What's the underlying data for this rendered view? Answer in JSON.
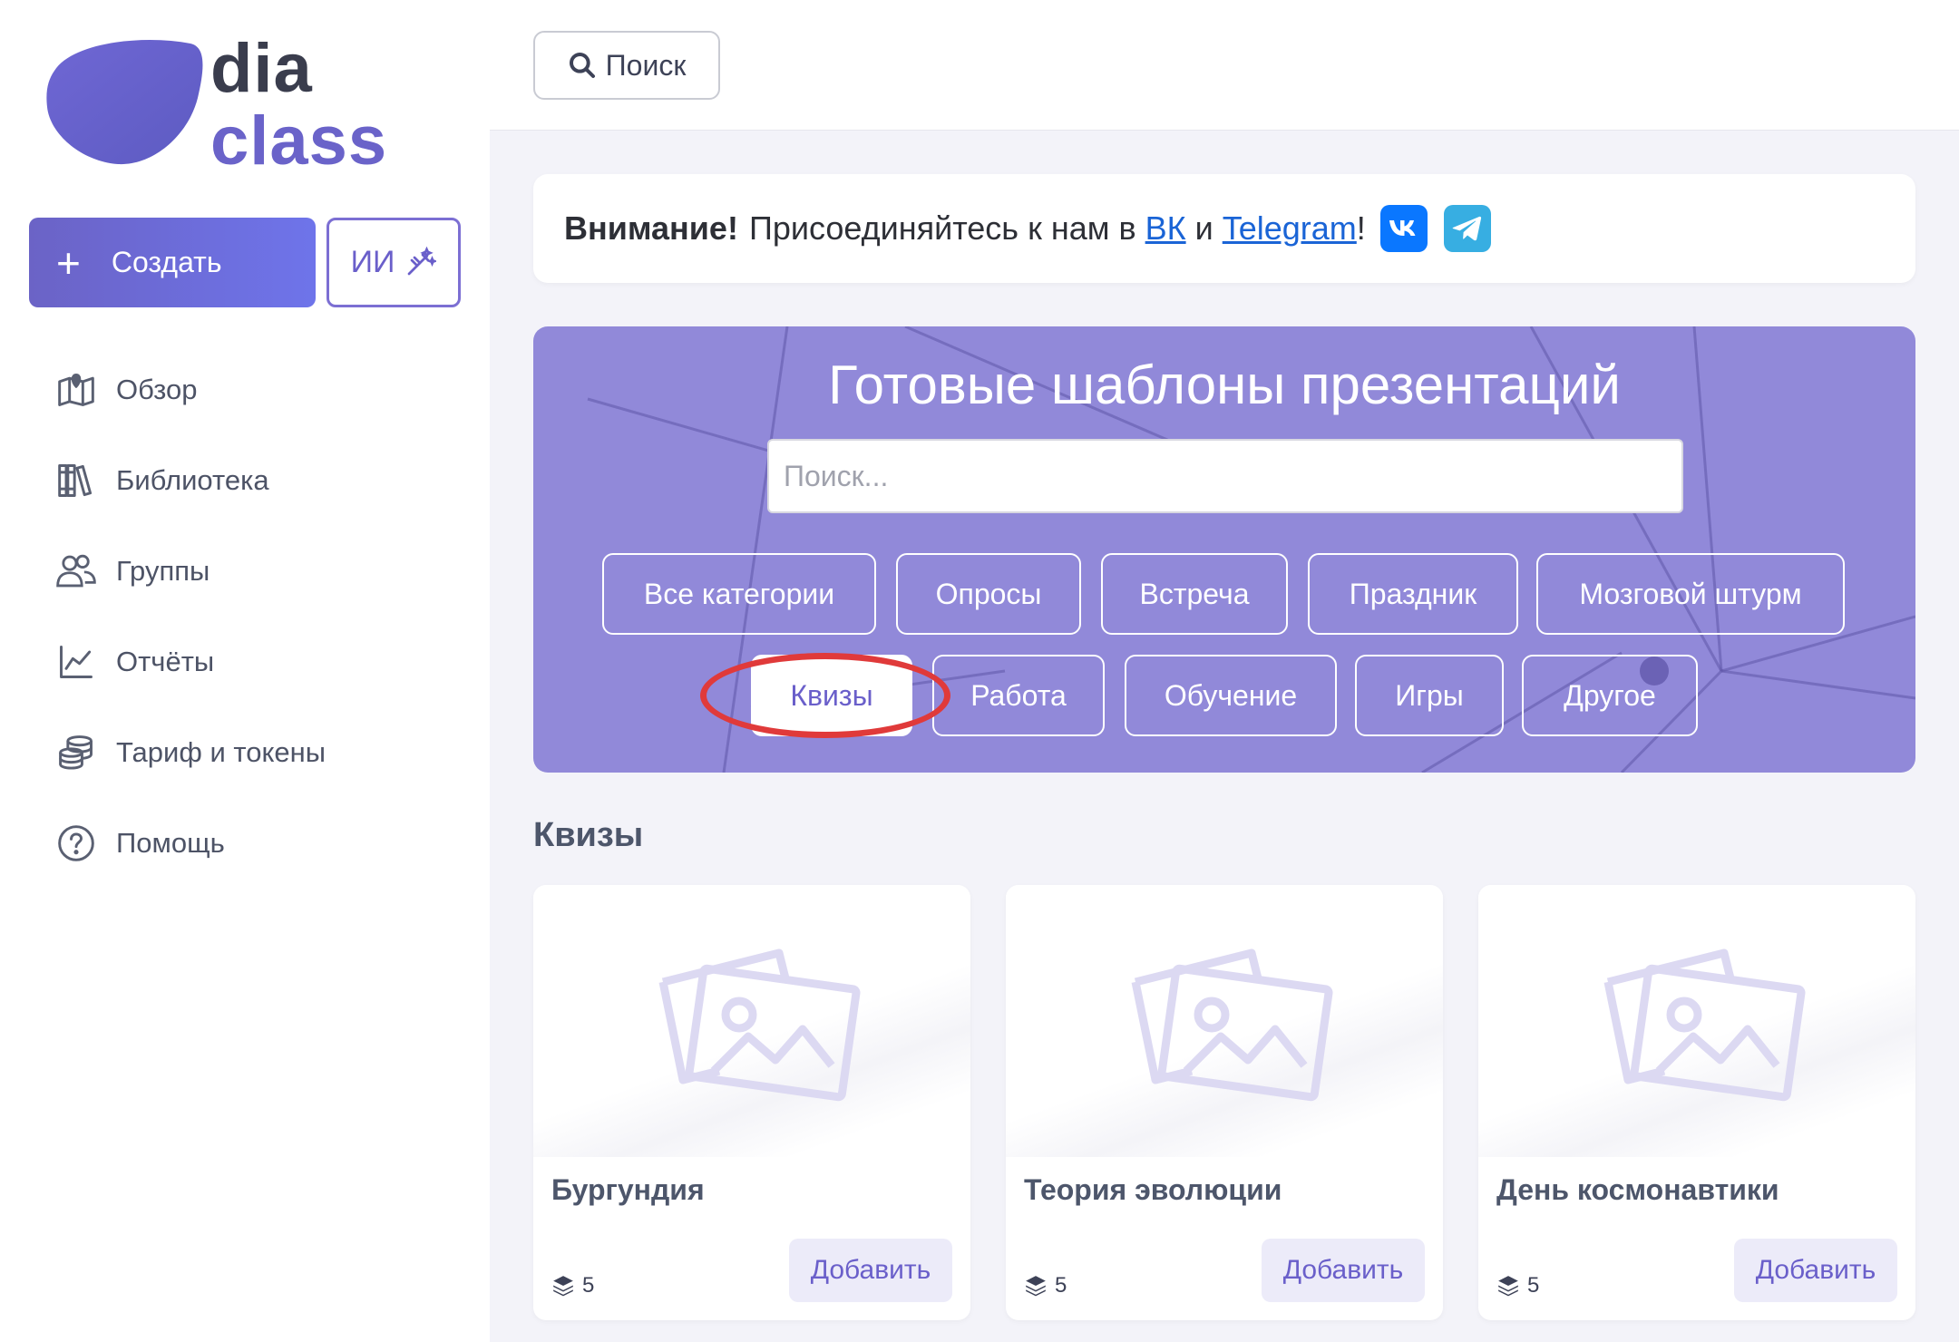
{
  "brand": {
    "line1": "dia",
    "line2": "class",
    "accent": "#6a63c9",
    "dark": "#3a3d4d"
  },
  "sidebar": {
    "create_label": "Создать",
    "ai_label": "ИИ",
    "items": [
      {
        "label": "Обзор",
        "icon": "map-icon"
      },
      {
        "label": "Библиотека",
        "icon": "library-icon"
      },
      {
        "label": "Группы",
        "icon": "users-icon"
      },
      {
        "label": "Отчёты",
        "icon": "chart-line-icon"
      },
      {
        "label": "Тариф и токены",
        "icon": "coins-icon"
      },
      {
        "label": "Помощь",
        "icon": "help-circle-icon"
      }
    ]
  },
  "topbar": {
    "search_label": "Поиск"
  },
  "notice": {
    "bold": "Внимание!",
    "text": "Присоединяйтесь к нам в",
    "vk_link": "ВК",
    "conj": "и",
    "tg_link": "Telegram",
    "end": "!",
    "vk_color": "#0a77ff",
    "tg_color": "#37aee2"
  },
  "hero": {
    "title": "Готовые шаблоны презентаций",
    "search_placeholder": "Поиск...",
    "bg_color": "#9189d9",
    "categories_row1": [
      "Все категории",
      "Опросы",
      "Встреча",
      "Праздник",
      "Мозговой штурм"
    ],
    "categories_row2": [
      "Квизы",
      "Работа",
      "Обучение",
      "Игры",
      "Другое"
    ],
    "active_category": "Квизы"
  },
  "section": {
    "title": "Квизы"
  },
  "cards": [
    {
      "title": "Бургундия",
      "slides": "5",
      "add_label": "Добавить"
    },
    {
      "title": "Теория эволюции",
      "slides": "5",
      "add_label": "Добавить"
    },
    {
      "title": "День космонавтики",
      "slides": "5",
      "add_label": "Добавить"
    }
  ]
}
